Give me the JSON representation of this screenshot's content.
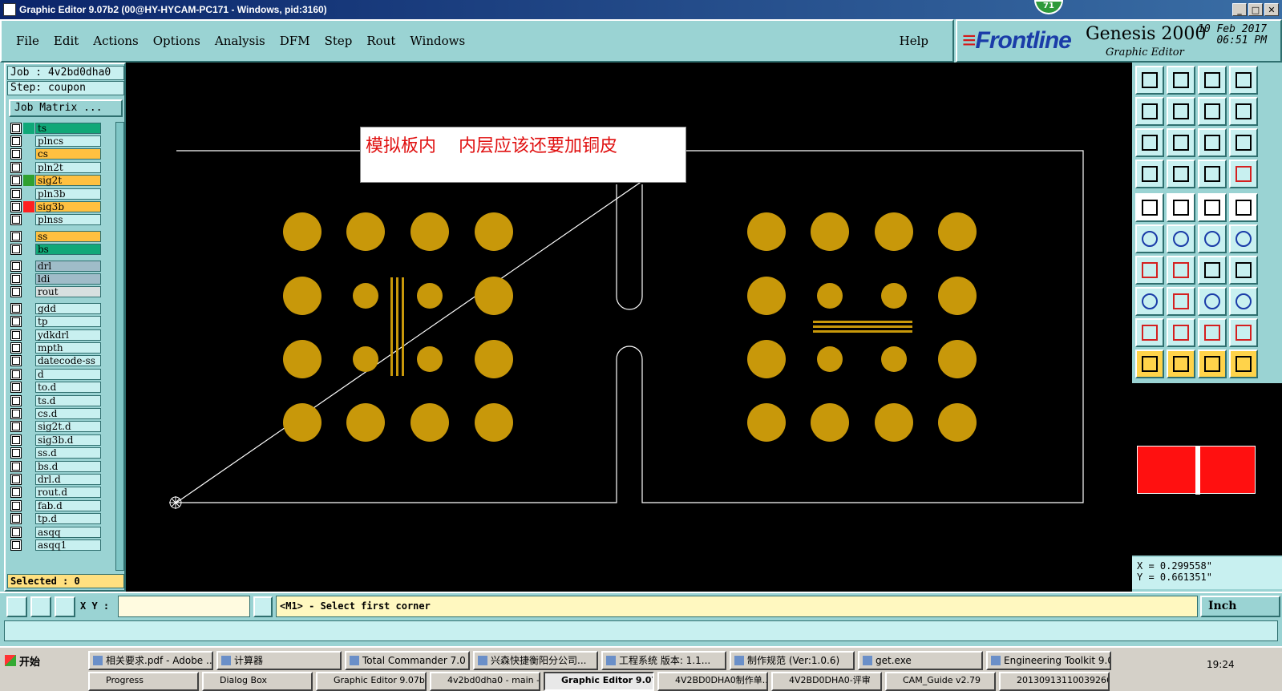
{
  "window": {
    "title": "Graphic Editor 9.07b2 (00@HY-HYCAM-PC171 - Windows, pid:3160)",
    "notification_count": "71"
  },
  "menu": {
    "items": [
      "File",
      "Edit",
      "Actions",
      "Options",
      "Analysis",
      "DFM",
      "Step",
      "Rout",
      "Windows"
    ],
    "help": "Help"
  },
  "brand": {
    "logo": "Frontline",
    "product": "Genesis 2000",
    "subtitle": "Graphic Editor",
    "date": "10 Feb 2017",
    "time": "06:51 PM"
  },
  "job": {
    "job_label": "Job : 4v2bd0dha0",
    "step_label": "Step: coupon",
    "matrix_button": "Job Matrix ..."
  },
  "layers": [
    {
      "name": "ts",
      "color": "#10a878",
      "marker": "#10a878"
    },
    {
      "name": "plncs",
      "color": "#c8f0f0",
      "marker": ""
    },
    {
      "name": "cs",
      "color": "#ffc040",
      "marker": ""
    },
    {
      "name": "pln2t",
      "color": "#c8f0f0",
      "marker": ""
    },
    {
      "name": "sig2t",
      "color": "#ffc040",
      "marker": "#30a030"
    },
    {
      "name": "pln3b",
      "color": "#c8f0f0",
      "marker": ""
    },
    {
      "name": "sig3b",
      "color": "#ffc040",
      "marker": "#ff2020"
    },
    {
      "name": "plnss",
      "color": "#c8f0f0",
      "marker": ""
    },
    {
      "name": "ss",
      "color": "#ffc040",
      "marker": ""
    },
    {
      "name": "bs",
      "color": "#10a878",
      "marker": ""
    },
    {
      "name": "drl",
      "color": "#9fbcc8",
      "marker": ""
    },
    {
      "name": "ldi",
      "color": "#9fbcc8",
      "marker": ""
    },
    {
      "name": "rout",
      "color": "#d8e0e0",
      "marker": ""
    },
    {
      "name": "gdd",
      "color": "#c8f0f0",
      "marker": ""
    },
    {
      "name": "tp",
      "color": "#c8f0f0",
      "marker": ""
    },
    {
      "name": "ydkdrl",
      "color": "#c8f0f0",
      "marker": ""
    },
    {
      "name": "mpth",
      "color": "#c8f0f0",
      "marker": ""
    },
    {
      "name": "datecode-ss",
      "color": "#c8f0f0",
      "marker": ""
    },
    {
      "name": "d",
      "color": "#c8f0f0",
      "marker": ""
    },
    {
      "name": "to.d",
      "color": "#c8f0f0",
      "marker": ""
    },
    {
      "name": "ts.d",
      "color": "#c8f0f0",
      "marker": ""
    },
    {
      "name": "cs.d",
      "color": "#c8f0f0",
      "marker": ""
    },
    {
      "name": "sig2t.d",
      "color": "#c8f0f0",
      "marker": ""
    },
    {
      "name": "sig3b.d",
      "color": "#c8f0f0",
      "marker": ""
    },
    {
      "name": "ss.d",
      "color": "#c8f0f0",
      "marker": ""
    },
    {
      "name": "bs.d",
      "color": "#c8f0f0",
      "marker": ""
    },
    {
      "name": "drl.d",
      "color": "#c8f0f0",
      "marker": ""
    },
    {
      "name": "rout.d",
      "color": "#c8f0f0",
      "marker": ""
    },
    {
      "name": "fab.d",
      "color": "#c8f0f0",
      "marker": ""
    },
    {
      "name": "tp.d",
      "color": "#c8f0f0",
      "marker": ""
    },
    {
      "name": "asqq",
      "color": "#c8f0f0",
      "marker": ""
    },
    {
      "name": "asqq1",
      "color": "#c8f0f0",
      "marker": ""
    }
  ],
  "selected": "Selected : 0",
  "annotation": "模拟板内    内层应该还要加铜皮",
  "colors": {
    "pad": "#c8980a",
    "outline": "#ffffff",
    "canvas": "#000000",
    "overview_fill": "#ff1010"
  },
  "coords": {
    "x": "X = 0.299558\"",
    "y": "Y = 0.661351\""
  },
  "cmd": {
    "xy_label": "X Y :",
    "prompt": "<M1> - Select first corner",
    "units": "Inch"
  },
  "taskbar": {
    "start": "开始",
    "row1": [
      "相关要求.pdf - Adobe ...",
      "计算器",
      "Total Commander 7.0 p...",
      "兴森快捷衡阳分公司...",
      "工程系统  版本: 1.1...",
      "制作规范 (Ver:1.0.6)",
      "get.exe",
      "Engineering Toolkit 9.0..."
    ],
    "row2": [
      "Progress",
      "Dialog Box",
      "Graphic Editor 9.07b...",
      "4v2bd0dha0 - main - ...",
      "Graphic Editor 9.07...",
      "4V2BD0DHA0制作单...",
      "4V2BD0DHA0-评审",
      "CAM_Guide v2.79",
      "20130913110039266..."
    ],
    "clock": "19:24"
  }
}
